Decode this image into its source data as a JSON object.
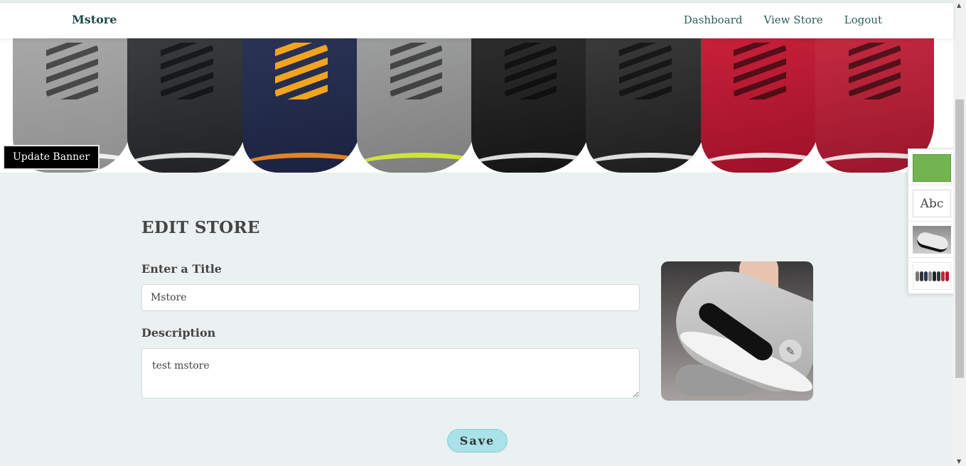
{
  "navbar": {
    "brand": "Mstore",
    "links": [
      {
        "label": "Dashboard"
      },
      {
        "label": "View Store"
      },
      {
        "label": "Logout"
      }
    ]
  },
  "banner": {
    "update_button_label": "Update Banner"
  },
  "edit_store": {
    "heading": "EDIT STORE",
    "title_label": "Enter a Title",
    "title_value": "Mstore",
    "description_label": "Description",
    "description_value": "test mstore",
    "save_label": "Save"
  },
  "side_panel": {
    "text_sample": "Abc",
    "color_swatch": "#72b550"
  },
  "colors": {
    "background": "#ebf0f0",
    "save_button": "#a9e2e8",
    "brand_text": "#1f4a4a"
  },
  "icons": {
    "edit_image": "pencil-icon",
    "scroll_up": "scroll-up-arrow-icon",
    "scroll_down": "scroll-down-arrow-icon"
  }
}
